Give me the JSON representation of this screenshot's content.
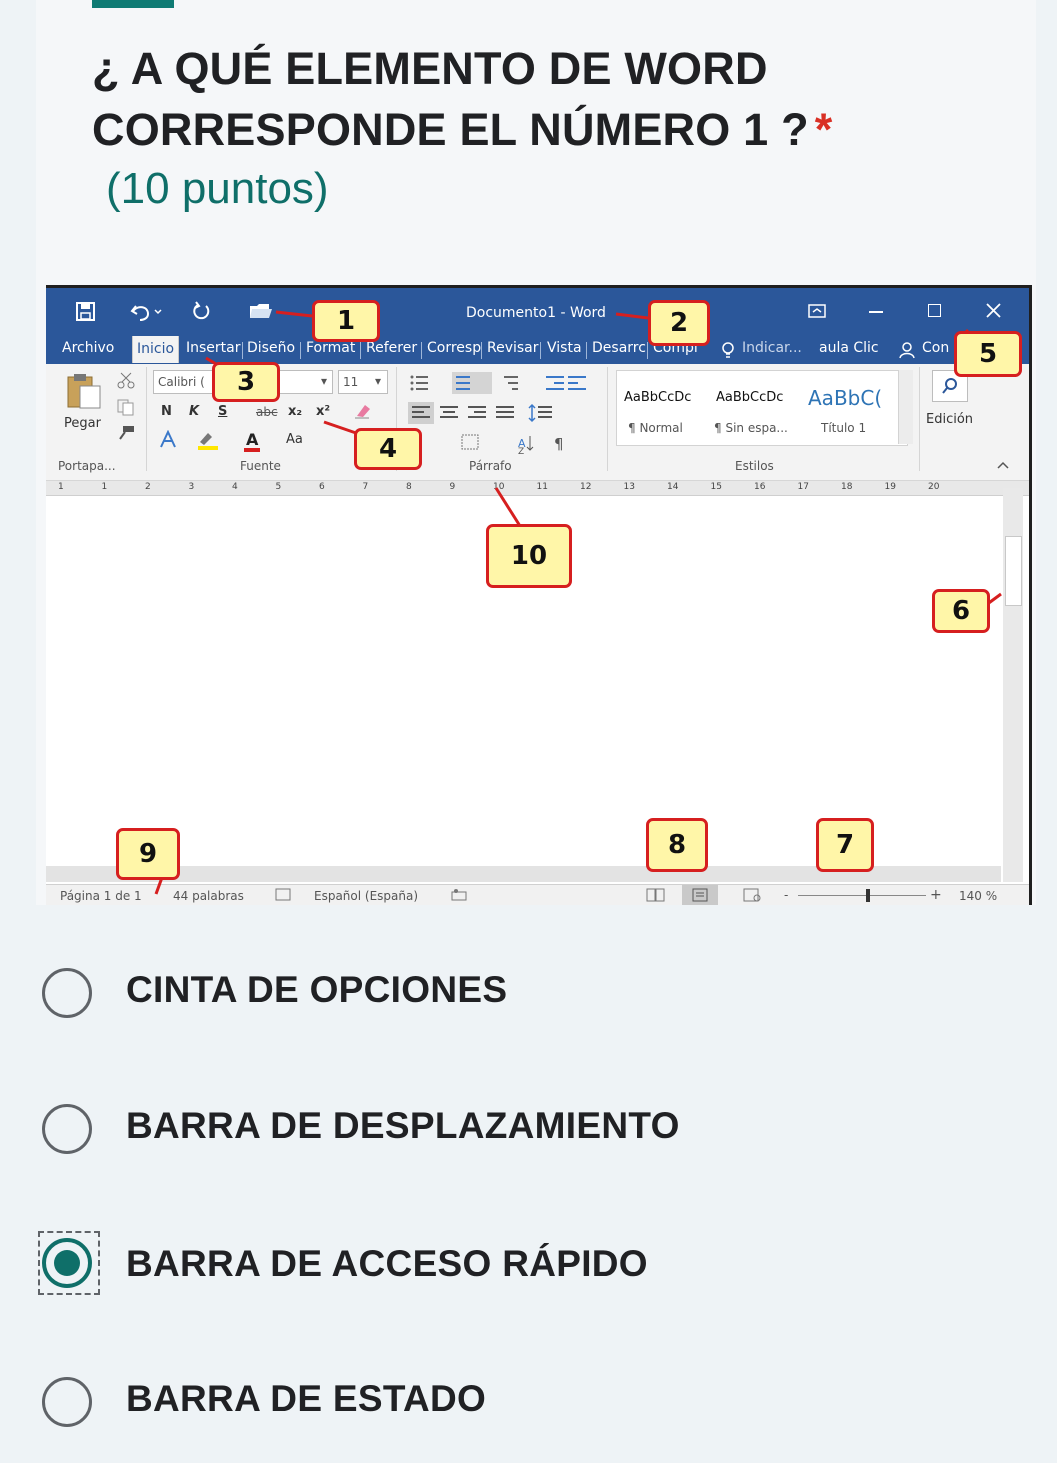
{
  "question": {
    "title": "¿ A QUÉ ELEMENTO DE WORD CORRESPONDE EL NÚMERO 1 ?",
    "required_mark": "*",
    "points": "(10 puntos)"
  },
  "word": {
    "window_title": "Documento1 - Word",
    "tabs": [
      "Archivo",
      "Inicio",
      "Insertar",
      "Diseño",
      "Format",
      "Referer",
      "Corresp",
      "Revisar",
      "Vista",
      "Desarrc",
      "Compl",
      "Indicar...",
      "aula Clic",
      "Con"
    ],
    "ribbon": {
      "paste_label": "Pegar",
      "font_name": "Calibri (",
      "font_size": "11",
      "bold": "N",
      "italic": "K",
      "underline": "S",
      "strike": "abc",
      "subscript": "x₂",
      "superscript": "x²",
      "font_color": "A",
      "change_case": "Aa",
      "style_samples": [
        "AaBbCcDc",
        "AaBbCcDc",
        "AaBbC("
      ],
      "style_names": [
        "¶ Normal",
        "¶ Sin espa...",
        "Título 1"
      ],
      "edit_label": "Edición",
      "groups": [
        "Portapa...",
        "Fuente",
        "Párrafo",
        "Estilos"
      ]
    },
    "ruler_numbers": [
      "1",
      "1",
      "2",
      "3",
      "4",
      "5",
      "6",
      "7",
      "8",
      "9",
      "10",
      "11",
      "12",
      "13",
      "14",
      "15",
      "16",
      "17",
      "18",
      "19",
      "20"
    ],
    "status": {
      "page": "Página 1 de 1",
      "words": "44 palabras",
      "language": "Español (España)",
      "zoom_minus": "-",
      "zoom_plus": "+",
      "zoom": "140 %"
    },
    "callouts": [
      "1",
      "2",
      "3",
      "4",
      "5",
      "6",
      "7",
      "8",
      "9",
      "10"
    ],
    "colors": {
      "title_bar": "#2b579a",
      "callout_fill": "#fff6a8",
      "callout_border": "#d61f1f"
    }
  },
  "options": [
    {
      "label": "CINTA DE OPCIONES",
      "selected": false
    },
    {
      "label": "BARRA DE DESPLAZAMIENTO",
      "selected": false
    },
    {
      "label": "BARRA DE ACCESO RÁPIDO",
      "selected": true
    },
    {
      "label": "BARRA DE ESTADO",
      "selected": false
    }
  ],
  "colors": {
    "accent": "#0f6f69",
    "required": "#d93025"
  }
}
